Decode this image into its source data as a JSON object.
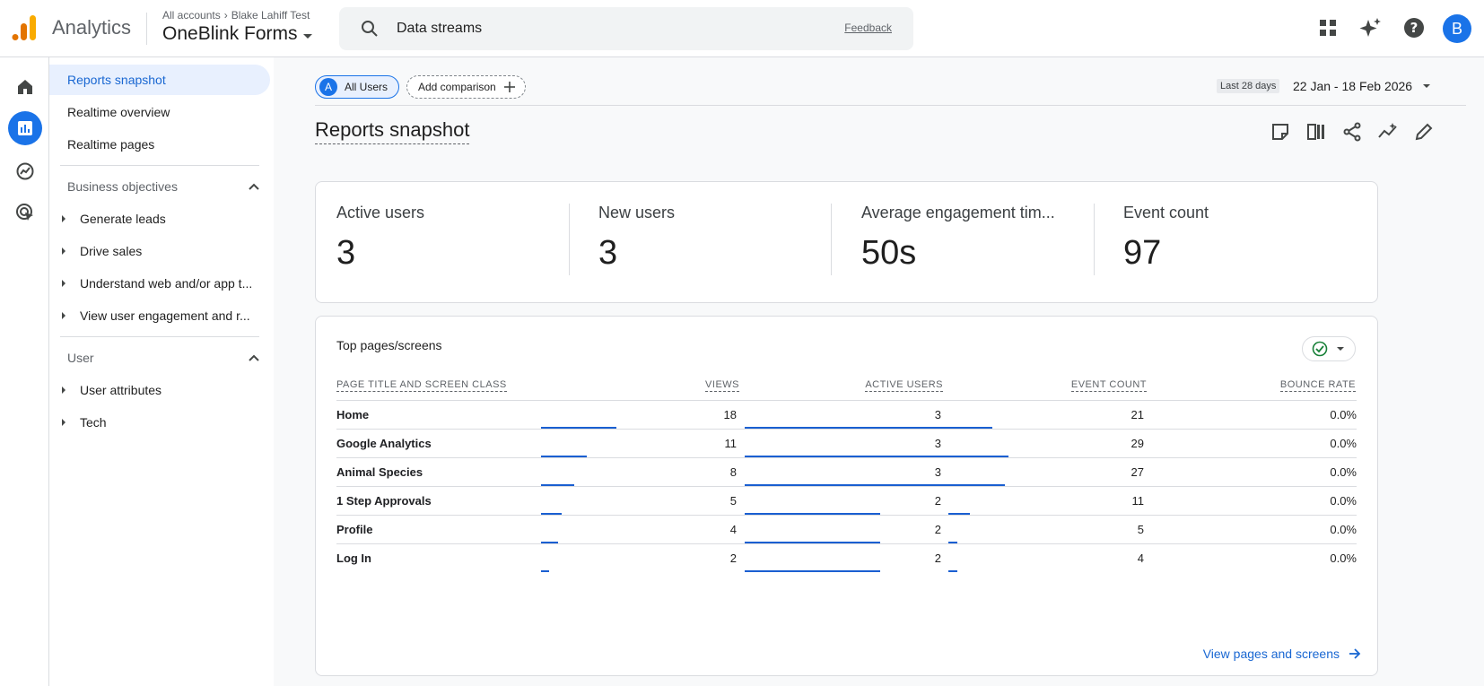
{
  "app": {
    "name": "Analytics",
    "breadcrumb": [
      "All accounts",
      "Blake Lahiff Test"
    ],
    "property": "OneBlink Forms"
  },
  "search": {
    "value": "Data streams",
    "feedback": "Feedback"
  },
  "header_icons": [
    "apps-grid-icon",
    "sparkle-icon",
    "help-icon"
  ],
  "avatar_letter": "B",
  "rail_icons": [
    "home-icon",
    "reports-icon",
    "explore-icon",
    "advertising-icon"
  ],
  "nav": {
    "items": [
      {
        "label": "Reports snapshot",
        "active": true
      },
      {
        "label": "Realtime overview"
      },
      {
        "label": "Realtime pages"
      }
    ],
    "sections": [
      {
        "label": "Business objectives",
        "items": [
          "Generate leads",
          "Drive sales",
          "Understand web and/or app t...",
          "View user engagement and r..."
        ]
      },
      {
        "label": "User",
        "items": [
          "User attributes",
          "Tech"
        ]
      }
    ]
  },
  "comparison": {
    "segment_badge": "A",
    "segment": "All Users",
    "add": "Add comparison"
  },
  "date": {
    "label": "Last 28 days",
    "range": "22 Jan - 18 Feb 2026"
  },
  "page_title": "Reports snapshot",
  "metrics": [
    {
      "label": "Active users",
      "value": "3"
    },
    {
      "label": "New users",
      "value": "3"
    },
    {
      "label": "Average engagement tim...",
      "value": "50s"
    },
    {
      "label": "Event count",
      "value": "97"
    }
  ],
  "table": {
    "title": "Top pages/screens",
    "columns": [
      "PAGE TITLE AND SCREEN CLASS",
      "VIEWS",
      "ACTIVE USERS",
      "EVENT COUNT",
      "BOUNCE RATE"
    ],
    "rows": [
      {
        "page": "Home",
        "views": 18,
        "active_users": 3,
        "event_count": 21,
        "bounce_rate": "0.0%"
      },
      {
        "page": "Google Analytics",
        "views": 11,
        "active_users": 3,
        "event_count": 29,
        "bounce_rate": "0.0%"
      },
      {
        "page": "Animal Species",
        "views": 8,
        "active_users": 3,
        "event_count": 27,
        "bounce_rate": "0.0%"
      },
      {
        "page": "1 Step Approvals",
        "views": 5,
        "active_users": 2,
        "event_count": 11,
        "bounce_rate": "0.0%"
      },
      {
        "page": "Profile",
        "views": 4,
        "active_users": 2,
        "event_count": 5,
        "bounce_rate": "0.0%"
      },
      {
        "page": "Log In",
        "views": 2,
        "active_users": 2,
        "event_count": 4,
        "bounce_rate": "0.0%"
      }
    ],
    "link": "View pages and screens"
  },
  "colors": {
    "accent": "#1a73e8",
    "bar": "#1a5fd1"
  }
}
